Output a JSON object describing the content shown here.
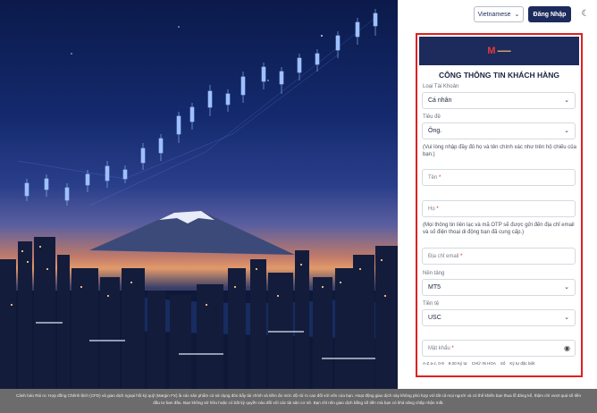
{
  "header": {
    "language_label": "Vietnamese",
    "login_label": "Đăng Nhập",
    "theme_icon": "brightness-icon"
  },
  "form": {
    "title": "CÔNG THÔNG TIN KHÁCH HÀNG",
    "account_type": {
      "label": "Loại Tài Khoản",
      "value": "Cá nhân"
    },
    "salutation": {
      "label": "Tiêu đề",
      "value": "Ông."
    },
    "name_note": "(Vui lòng nhập đầy đủ họ và tên chính xác như trên hộ chiếu của bạn.)",
    "first_name": {
      "placeholder": "Tên"
    },
    "last_name": {
      "placeholder": "Họ"
    },
    "contact_note": "(Mọi thông tin liên lạc và mã OTP sẽ được gửi đến địa chỉ email và số điện thoại di động bạn đã cung cấp.)",
    "email": {
      "placeholder": "Địa chỉ email"
    },
    "platform": {
      "label": "Nền tảng",
      "value": "MT5"
    },
    "currency": {
      "label": "Tiền tệ",
      "value": "USC"
    },
    "password": {
      "placeholder": "Mật khẩu"
    },
    "password_hints": [
      "A-Z a-z, 0-9",
      "8-20 Ký tự",
      "CHỮ IN HOA",
      "Số",
      "Ký tự đặc biệt"
    ]
  },
  "footer": {
    "disclaimer": "Cảnh báo Rủi ro: Hợp đồng Chênh lệch (CFD) và giao dịch ngoại hối ký quỹ (Margin FX) là các sản phẩm có sử dụng đòn bẩy tài chính và tiềm ẩn mức độ rủi ro cao đối với vốn của bạn. Hoạt động giao dịch này không phù hợp với tất cả mọi người và có thể khiến bạn thua lỗ đáng kể, thậm chí vượt quá số tiền đầu tư ban đầu. Bạn không sở hữu hoặc có bất kỳ quyền nào đối với các tài sản cơ sở. Bạn chỉ nên giao dịch bằng số tiền mà bạn có khả năng chấp nhận mất."
  },
  "colors": {
    "brand_navy": "#1d2a5c",
    "highlight_red": "#e02020"
  }
}
